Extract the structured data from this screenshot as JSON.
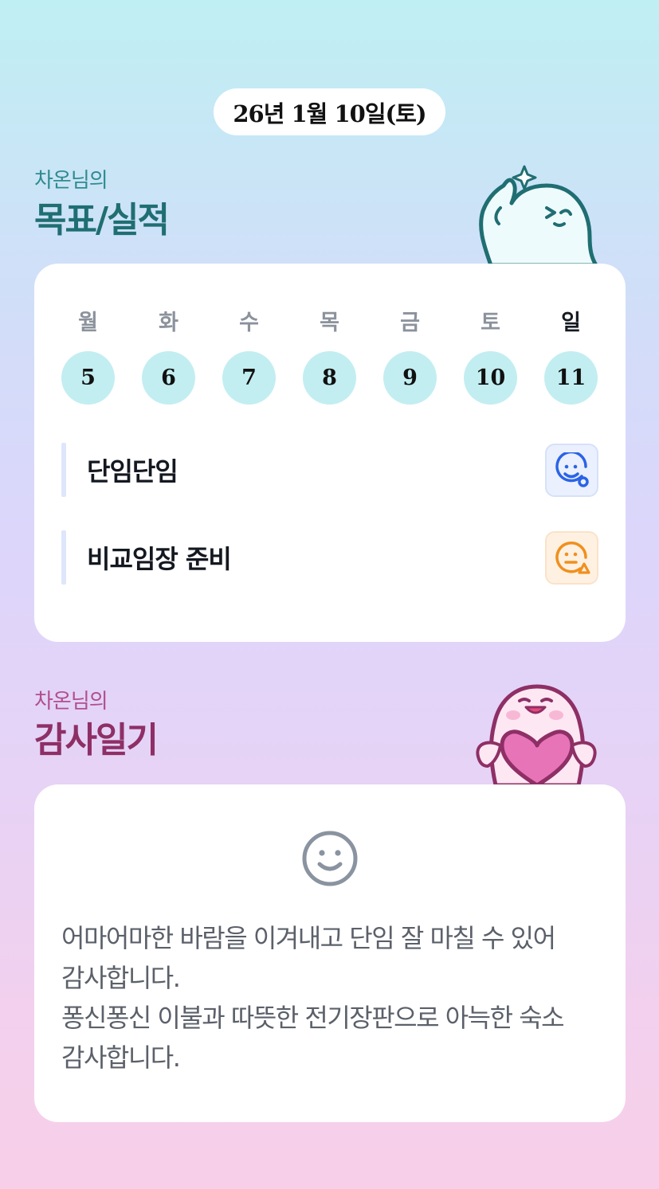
{
  "date_label": "26년 1월 10일(토)",
  "goals_section": {
    "subtitle": "차온님의",
    "title": "목표/실적"
  },
  "week": {
    "weekdays": [
      "월",
      "화",
      "수",
      "목",
      "금",
      "토",
      "일"
    ],
    "days": [
      "5",
      "6",
      "7",
      "8",
      "9",
      "10",
      "11"
    ],
    "highlighted_weekday": "일"
  },
  "goals": [
    {
      "text": "단임단임",
      "status_icon": "smile-circle-icon",
      "status_color": "#2b63e6"
    },
    {
      "text": "비교임장 준비",
      "status_icon": "neutral-triangle-icon",
      "status_color": "#f0901e"
    }
  ],
  "gratitude_section": {
    "subtitle": "차온님의",
    "title": "감사일기"
  },
  "gratitude": {
    "mood_icon": "smile-face-icon",
    "lines": [
      "어마어마한 바람을 이겨내고 단임 잘 마칠 수 있어",
      "감사합니다.",
      "퐁신퐁신 이불과 따뜻한 전기장판으로 아늑한 숙소",
      "감사합니다."
    ]
  },
  "colors": {
    "teal": "#2f8b8f",
    "plum": "#b14f8d",
    "day_circle": "#c3eef1"
  }
}
